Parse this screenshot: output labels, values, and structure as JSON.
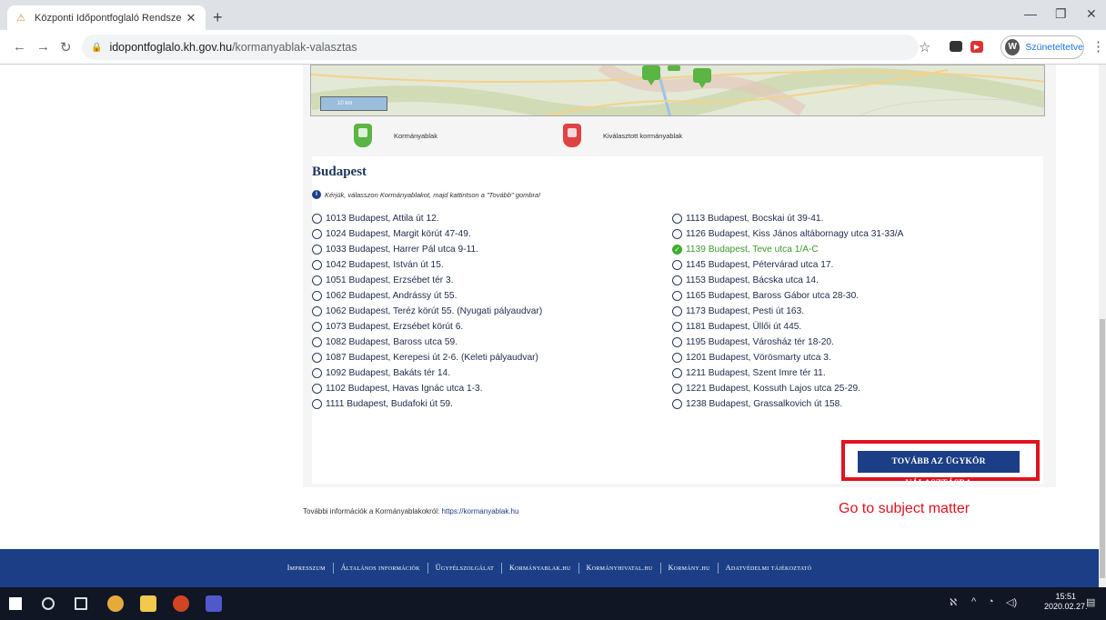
{
  "browser": {
    "tab_title": "Központi Időpontfoglaló Rendsze",
    "url_host": "idopontfoglalo.kh.gov.hu",
    "url_path": "/kormanyablak-valasztas",
    "profile_initial": "W",
    "profile_label": "Szüneteltetve"
  },
  "map": {
    "scale_label": "10 km"
  },
  "legend": {
    "items": [
      {
        "label": "Kormányablak",
        "color": "#5ab543"
      },
      {
        "label": "Kiválasztott kormányablak",
        "color": "#e04343"
      }
    ]
  },
  "panel": {
    "city": "Budapest",
    "instruction": "Kérjük, válasszon Kormányablakot, majd kattintson a \"Tovább\" gombra!",
    "left_options": [
      "1013 Budapest, Attila út 12.",
      "1024 Budapest, Margit körút 47-49.",
      "1033 Budapest, Harrer Pál utca 9-11.",
      "1042 Budapest, István út 15.",
      "1051 Budapest, Erzsébet tér 3.",
      "1062 Budapest, Andrássy út 55.",
      "1062 Budapest, Teréz körút 55. (Nyugati pályaudvar)",
      "1073 Budapest, Erzsébet körút 6.",
      "1082 Budapest, Baross utca 59.",
      "1087 Budapest, Kerepesi út 2-6. (Keleti pályaudvar)",
      "1092 Budapest, Bakáts tér 14.",
      "1102 Budapest, Havas Ignác utca 1-3.",
      "1111 Budapest, Budafoki út 59."
    ],
    "right_options": [
      "1113 Budapest, Bocskai út 39-41.",
      "1126 Budapest, Kiss János altábornagy utca 31-33/A",
      "1139 Budapest, Teve utca 1/A-C",
      "1145 Budapest, Pétervárad utca 17.",
      "1153 Budapest, Bácska utca 14.",
      "1165 Budapest, Baross Gábor utca 28-30.",
      "1173 Budapest, Pesti út 163.",
      "1181 Budapest, Üllői út 445.",
      "1195 Budapest, Városház tér 18-20.",
      "1201 Budapest, Vörösmarty utca 3.",
      "1211 Budapest, Szent Imre tér 11.",
      "1221 Budapest, Kossuth Lajos utca 25-29.",
      "1238 Budapest, Grassalkovich út 158."
    ],
    "selected": "1139 Budapest, Teve utca 1/A-C",
    "next_button": "TOVÁBB AZ ÜGYKÖR VÁLASZTÁSRA"
  },
  "more_info": {
    "text": "További információk a Kormányablakokról: ",
    "link": "https://kormanyablak.hu"
  },
  "annotation": "Go to subject matter",
  "footer": {
    "links": [
      "Impresszum",
      "Általános információk",
      "Ügyfélszolgálat",
      "Kormányablak.hu",
      "Kormányhivatal.hu",
      "Kormány.hu",
      "Adatvédelmi tájékoztató"
    ]
  },
  "taskbar": {
    "time": "15:51",
    "date": "2020.02.27."
  }
}
